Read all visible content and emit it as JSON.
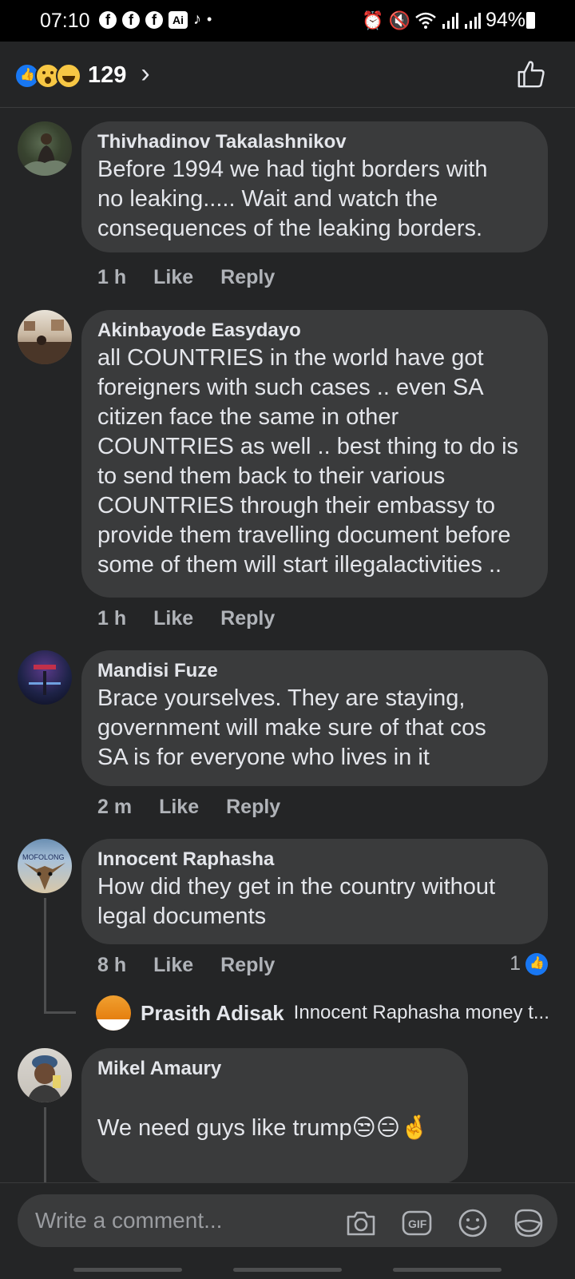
{
  "status_bar": {
    "time": "07:10",
    "ai_badge": "Ai",
    "battery": "94%"
  },
  "header": {
    "reaction_icons": [
      "like-icon",
      "wow-icon",
      "haha-icon"
    ],
    "reaction_count": "129",
    "chevron": "›"
  },
  "comments": [
    {
      "author": "Thivhadinov Takalashnikov",
      "lines": [
        "Before 1994 we had tight borders with",
        "no leaking..... Wait and watch the",
        "consequences of the leaking borders."
      ],
      "time": "1 h",
      "like": "Like",
      "reply": "Reply"
    },
    {
      "author": "Akinbayode Easydayo",
      "lines": [
        "all COUNTRIES in the world have got",
        "foreigners with such cases .. even SA",
        "citizen face the same in other",
        "COUNTRIES as well .. best thing to do is",
        "to send them back to their various",
        "COUNTRIES through their embassy to",
        "provide them travelling document before",
        "some of them will start illegalactivities .."
      ],
      "time": "1 h",
      "like": "Like",
      "reply": "Reply"
    },
    {
      "author": "Mandisi Fuze",
      "lines": [
        "Brace yourselves. They are staying,",
        "government will make sure of that cos",
        "SA is for everyone who lives in it"
      ],
      "time": "2 m",
      "like": "Like",
      "reply": "Reply"
    },
    {
      "author": "Innocent Raphasha",
      "lines": [
        "How did they get in the country without",
        "legal documents"
      ],
      "time": "8 h",
      "like": "Like",
      "reply": "Reply",
      "like_count": "1",
      "avatar_text": "MOFOLONG"
    },
    {
      "author": "Mikel Amaury",
      "lines": [
        "",
        "We need guys like trump😒😑🤞"
      ]
    }
  ],
  "reply_preview": {
    "author": "Prasith Adisak",
    "text": "Innocent Raphasha money t..."
  },
  "composer": {
    "placeholder": "Write a comment..."
  },
  "colors": {
    "background": "#242526",
    "bubble": "#3a3b3c",
    "text": "#e4e6eb",
    "meta": "#b0b3b8",
    "accent": "#1877f2"
  }
}
